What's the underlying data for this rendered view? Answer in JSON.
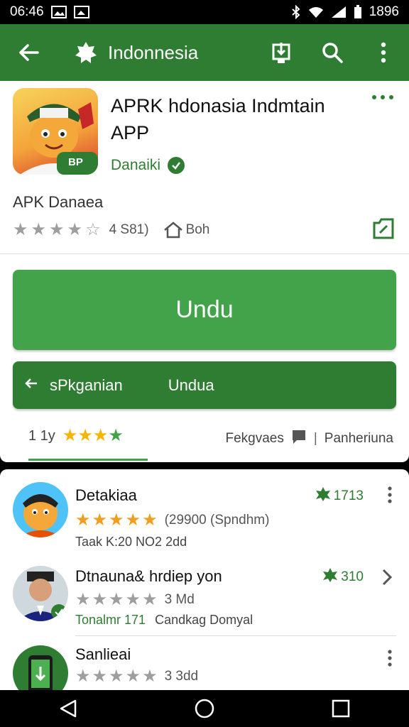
{
  "status_bar": {
    "time": "06:46",
    "battery": "1896"
  },
  "app_bar": {
    "title": "Indonnesia"
  },
  "app": {
    "name": "APRK hdonasia Indmtain APP",
    "developer": "Danaiki",
    "subtitle": "APK Danaea",
    "rating_count": "4 S81)",
    "category": "Boh",
    "icon_badge": "BP"
  },
  "buttons": {
    "install": "Undu",
    "secondary_left": "sPkganian",
    "secondary_right": "Undua"
  },
  "tabs": {
    "left_label": "1 1y",
    "right_label_1": "Fekgvaes",
    "right_label_2": "Panheriuna"
  },
  "list": [
    {
      "title": "Detakiaa",
      "rating_text": "(29900 (Spndhm)",
      "meta": "Taak K:20 NO2 2dd",
      "badge": "1713"
    },
    {
      "title": "Dtnauna& hrdiep yon",
      "rating_text": "3 Md",
      "meta_green": "Tonalmr 171",
      "meta": "Candkag Domyal",
      "badge": "310"
    },
    {
      "title": "Sanlieai",
      "rating_text": "3 3dd"
    }
  ],
  "colors": {
    "primary": "#2e7d32",
    "accent": "#43a34b",
    "star": "#f4b400"
  }
}
